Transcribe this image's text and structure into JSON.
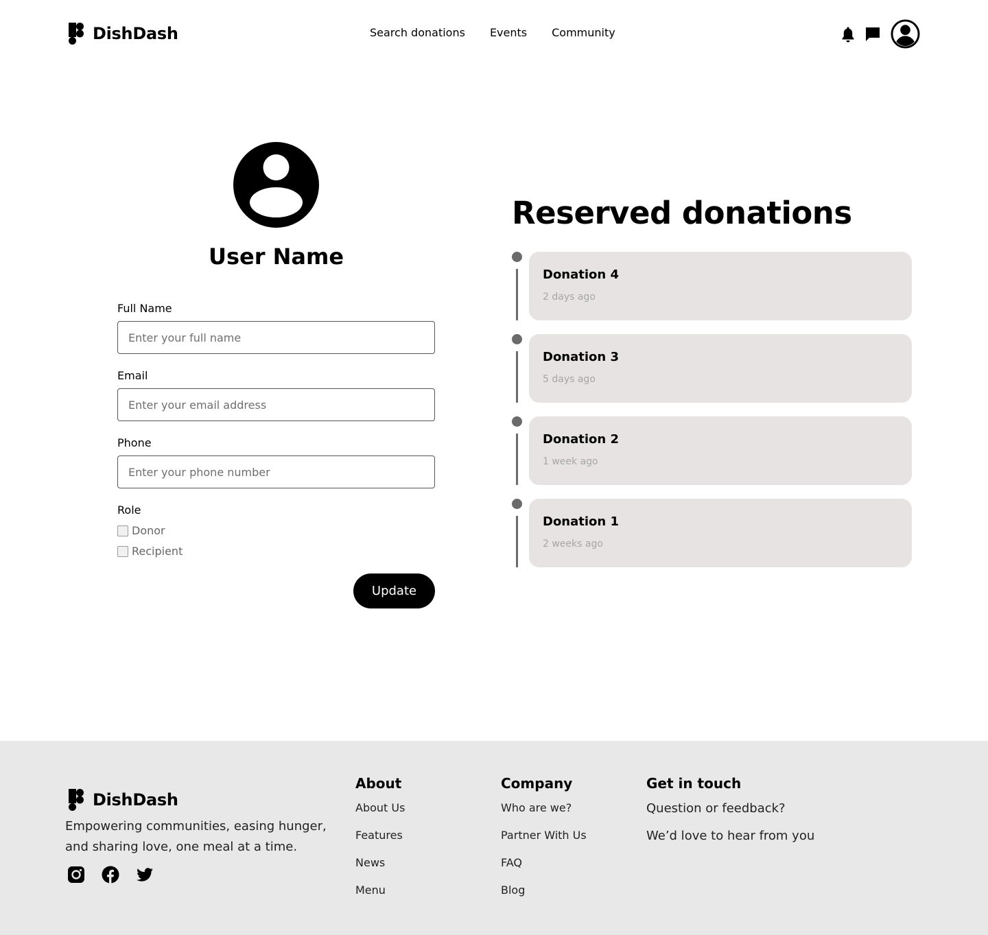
{
  "header": {
    "brand": "DishDash",
    "nav": [
      "Search donations",
      "Events",
      "Community"
    ],
    "icons": [
      "bell-icon",
      "chat-icon",
      "user-avatar-icon"
    ]
  },
  "profile": {
    "user_name": "User Name",
    "fields": [
      {
        "label": "Full Name",
        "placeholder": "Enter your full name",
        "value": ""
      },
      {
        "label": "Email",
        "placeholder": "Enter your email address",
        "value": ""
      },
      {
        "label": "Phone",
        "placeholder": "Enter your phone number",
        "value": ""
      }
    ],
    "role_label": "Role",
    "roles": [
      {
        "label": "Donor",
        "checked": false
      },
      {
        "label": "Recipient",
        "checked": false
      }
    ],
    "update_label": "Update"
  },
  "reserved": {
    "title": "Reserved donations",
    "items": [
      {
        "title": "Donation 4",
        "time": "2 days ago"
      },
      {
        "title": "Donation 3",
        "time": "5 days ago"
      },
      {
        "title": "Donation 2",
        "time": "1 week ago"
      },
      {
        "title": "Donation 1",
        "time": "2 weeks ago"
      }
    ]
  },
  "footer": {
    "brand": "DishDash",
    "tagline": "Empowering communities, easing hunger, and sharing love, one meal at a time.",
    "social": [
      "instagram-icon",
      "facebook-icon",
      "twitter-icon"
    ],
    "about": {
      "heading": "About",
      "links": [
        "About Us",
        "Features",
        "News",
        "Menu"
      ]
    },
    "company": {
      "heading": "Company",
      "links": [
        "Who are we?",
        "Partner With Us",
        "FAQ",
        "Blog"
      ]
    },
    "contact": {
      "heading": "Get in touch",
      "lines": [
        "Question or feedback?",
        "We’d love to hear from you"
      ]
    }
  },
  "colors": {
    "accent": "#000000",
    "card_bg": "#e6e3e2",
    "timeline": "#6b6b6b",
    "footer_bg": "#e8e8e8",
    "muted_text": "#a6a6a6"
  }
}
